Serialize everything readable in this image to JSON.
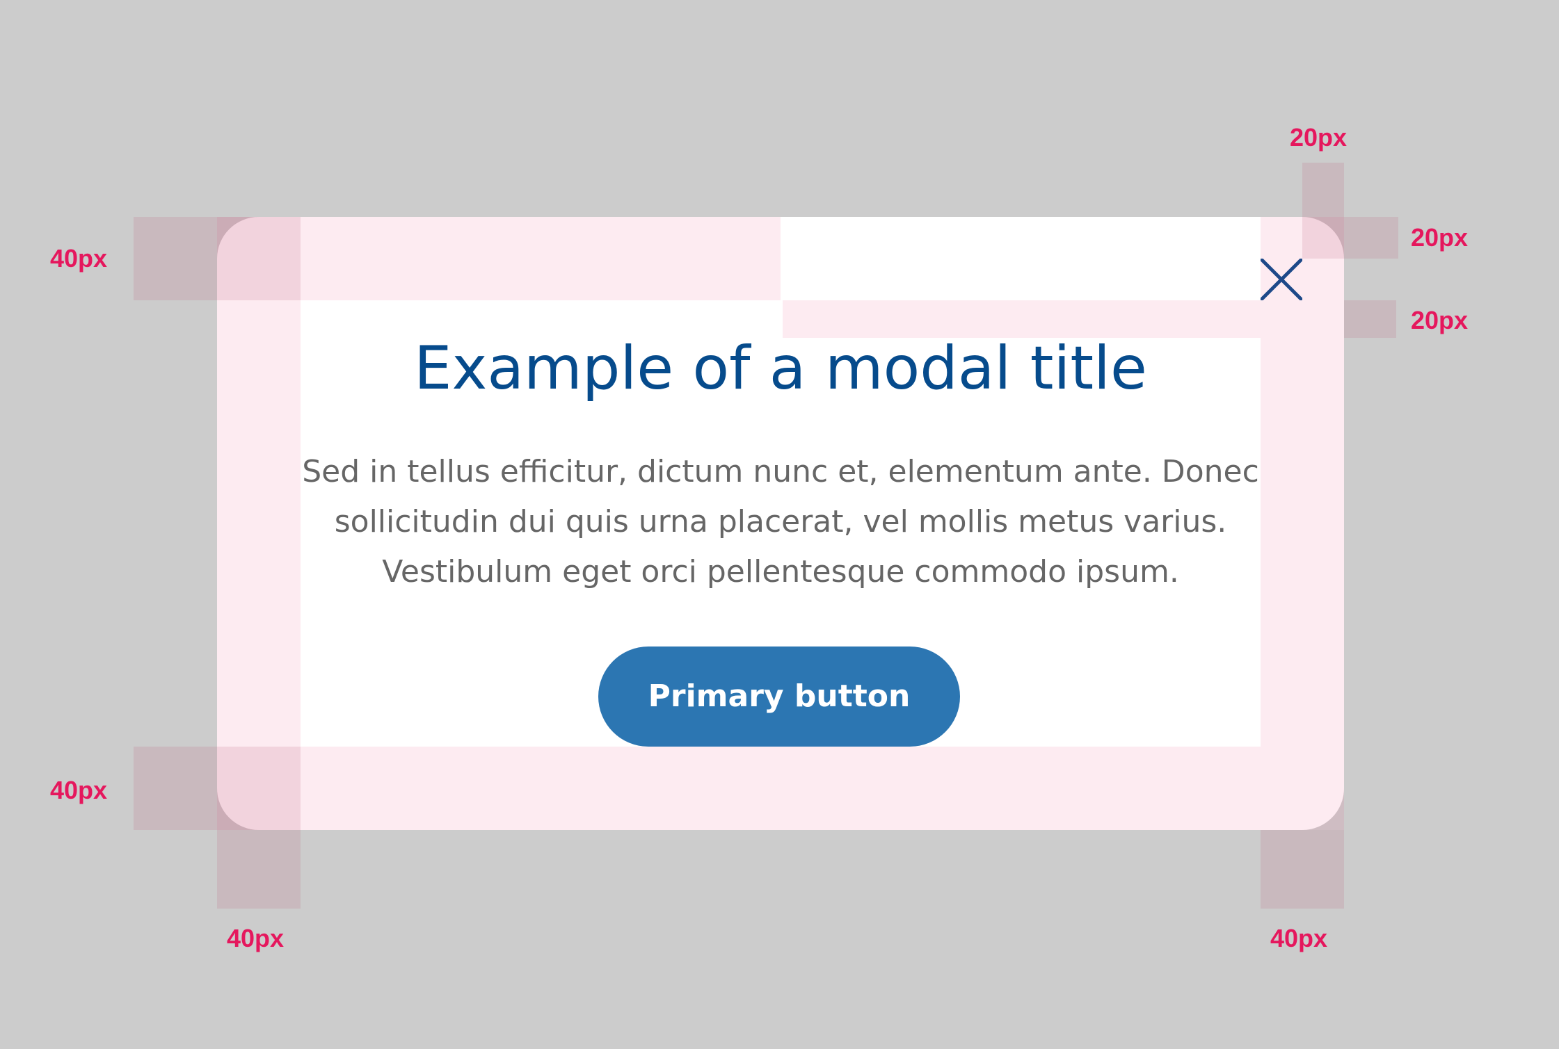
{
  "modal": {
    "title": "Example of a modal title",
    "body_lines": [
      "Sed in tellus efficitur, dictum nunc et, elementum ante. Donec",
      "sollicitudin dui quis urna placerat, vel mollis metus varius.",
      "Vestibulum eget orci pellentesque commodo ipsum."
    ],
    "primary_button_label": "Primary button",
    "close_icon": "close-icon"
  },
  "redlines": {
    "top_padding": "40px",
    "bottom_padding": "40px",
    "left_padding": "40px",
    "right_padding": "40px",
    "close_top_offset": "20px",
    "close_right_offset": "20px",
    "close_bottom_gap": "20px"
  },
  "colors": {
    "background": "#cccccc",
    "modal_background": "#ffffff",
    "title": "#064b8c",
    "body_text": "#666666",
    "primary_button": "#2c76b2",
    "close_icon": "#064b8c",
    "redline_label": "#e5175d",
    "redline_overlay": "#f03c78"
  }
}
